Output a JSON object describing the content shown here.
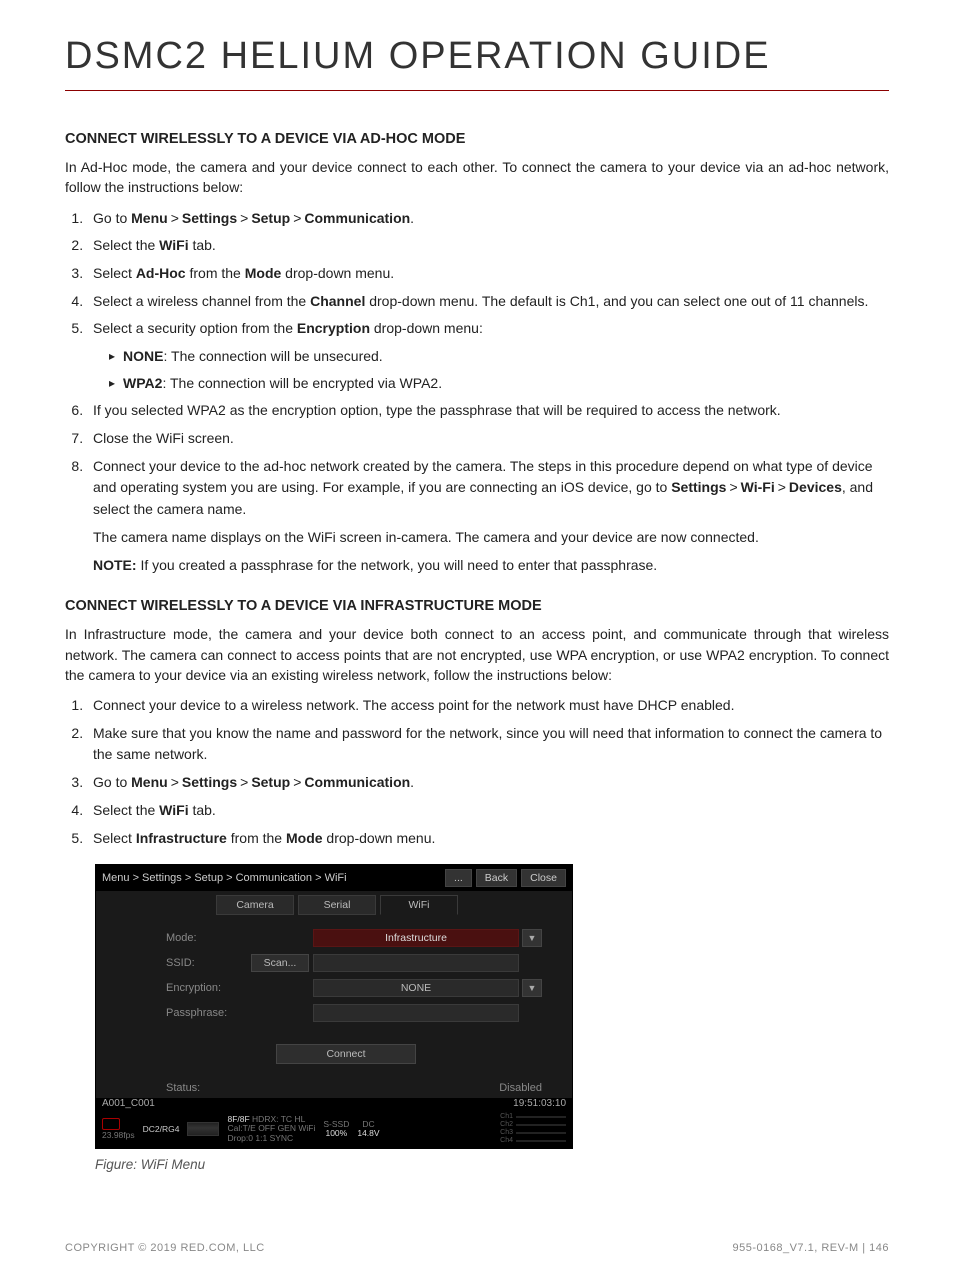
{
  "title": "DSMC2 HELIUM OPERATION GUIDE",
  "section1": {
    "heading": "CONNECT WIRELESSLY TO A DEVICE VIA AD-HOC MODE",
    "intro": "In Ad-Hoc mode, the camera and your device connect to each other. To connect the camera to your device via an ad-hoc network, follow the instructions below:",
    "step1_pre": "Go to ",
    "step1_menu": "Menu",
    "step1_settings": "Settings",
    "step1_setup": "Setup",
    "step1_comm": "Communication",
    "step2_pre": "Select the ",
    "step2_wifi": "WiFi",
    "step2_post": " tab.",
    "step3_pre": "Select ",
    "step3_adhoc": "Ad-Hoc",
    "step3_mid": " from the ",
    "step3_mode": "Mode",
    "step3_post": " drop-down menu.",
    "step4_pre": "Select a wireless channel from the ",
    "step4_channel": "Channel",
    "step4_post": " drop-down menu. The default is Ch1, and you can select one out of 11 channels.",
    "step5_pre": "Select a security option from the ",
    "step5_enc": "Encryption",
    "step5_post": " drop-down menu:",
    "bullet1_b": "NONE",
    "bullet1_t": ": The connection will be unsecured.",
    "bullet2_b": "WPA2",
    "bullet2_t": ": The connection will be encrypted via WPA2.",
    "step6": "If you selected WPA2 as the encryption option, type the passphrase that will be required to access the network.",
    "step7": "Close the WiFi screen.",
    "step8_a": "Connect your device to the ad-hoc network created by the camera. The steps in this procedure depend on what type of device and operating system you are using. For example, if you are connecting an iOS device, go to ",
    "step8_settings": "Settings",
    "step8_wifi": "Wi-Fi",
    "step8_devices": "Devices",
    "step8_b": ", and select the camera name.",
    "step8_p2": "The camera name displays on the WiFi screen in-camera. The camera and your device are now connected.",
    "step8_note_b": "NOTE:",
    "step8_note_t": " If you created a passphrase for the network, you will need to enter that passphrase."
  },
  "section2": {
    "heading": "CONNECT WIRELESSLY TO A DEVICE VIA INFRASTRUCTURE MODE",
    "intro": "In Infrastructure mode, the camera and your device both connect to an access point, and communicate through that wireless network. The camera can connect to access points that are not encrypted, use WPA encryption, or use WPA2 encryption. To connect the camera to your device via an existing wireless network, follow the instructions below:",
    "step1": "Connect your device to a wireless network. The access point for the network must have DHCP enabled.",
    "step2": "Make sure that you know the name and password for the network, since you will need that information to connect the camera to the same network.",
    "step3_pre": "Go to ",
    "step3_menu": "Menu",
    "step3_settings": "Settings",
    "step3_setup": "Setup",
    "step3_comm": "Communication",
    "step4_pre": "Select the ",
    "step4_wifi": "WiFi",
    "step4_post": " tab.",
    "step5_pre": "Select ",
    "step5_infra": "Infrastructure",
    "step5_mid": " from the ",
    "step5_mode": "Mode",
    "step5_post": " drop-down menu."
  },
  "camera": {
    "breadcrumb": "Menu > Settings > Setup > Communication > WiFi",
    "btn_dots": "...",
    "btn_back": "Back",
    "btn_close": "Close",
    "tab_camera": "Camera",
    "tab_serial": "Serial",
    "tab_wifi": "WiFi",
    "lbl_mode": "Mode:",
    "val_mode": "Infrastructure",
    "lbl_ssid": "SSID:",
    "btn_scan": "Scan...",
    "lbl_enc": "Encryption:",
    "val_enc": "NONE",
    "lbl_pass": "Passphrase:",
    "btn_connect": "Connect",
    "lbl_status": "Status:",
    "val_status": "Disabled",
    "clip": "A001_C001",
    "timecode": "19:51:03:10",
    "fps": "23.98fps",
    "color": "DC2/RG4",
    "hdrx_lbl": "8F/8F",
    "hdrx": "HDRX:",
    "tc": "TC",
    "hl": "HL",
    "cal": "Cal:T/E",
    "off": "OFF",
    "gen": "GEN",
    "wifi": "WiFi",
    "drop": "Drop:0",
    "ratio": "1:1",
    "sync": "SYNC",
    "ssd_lbl": "S-SSD",
    "ssd": "100%",
    "dc_lbl": "DC",
    "dc": "14.8V",
    "ch1": "Ch1",
    "ch2": "Ch2",
    "ch3": "Ch3",
    "ch4": "Ch4"
  },
  "figure_caption": "Figure: WiFi Menu",
  "footer": {
    "left": "COPYRIGHT © 2019 RED.COM, LLC",
    "right": "955-0168_V7.1, REV-M   |   146"
  }
}
